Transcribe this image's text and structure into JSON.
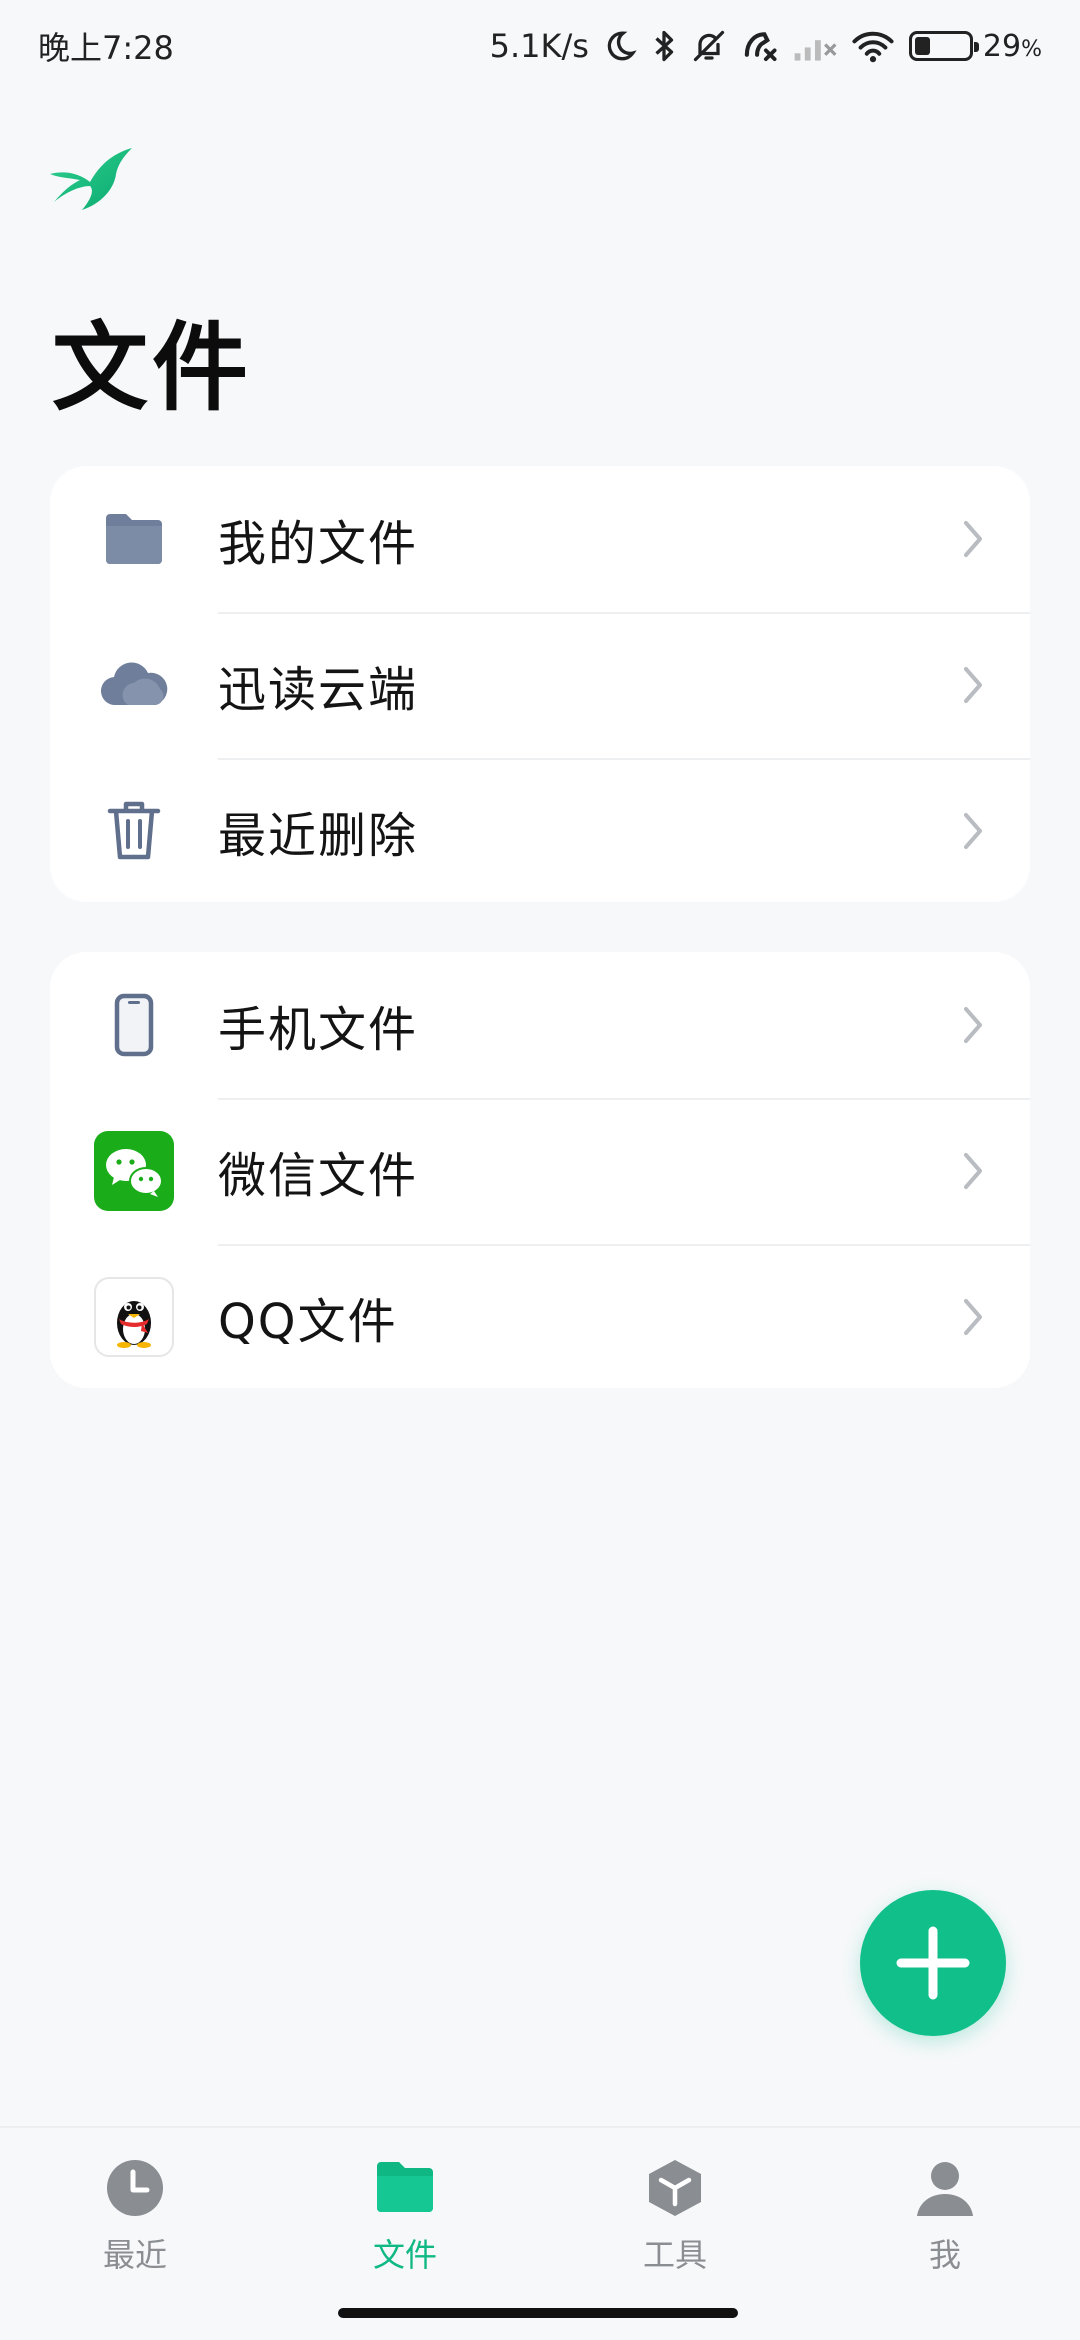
{
  "status_bar": {
    "time": "晚上7:28",
    "network_speed": "5.1K/s",
    "battery_percent": "29",
    "battery_unit": "%",
    "battery_level": 0.29
  },
  "page": {
    "title": "文件"
  },
  "groups": [
    {
      "items": [
        {
          "label": "我的文件",
          "icon": "folder-icon"
        },
        {
          "label": "迅读云端",
          "icon": "cloud-icon"
        },
        {
          "label": "最近删除",
          "icon": "trash-icon"
        }
      ]
    },
    {
      "items": [
        {
          "label": "手机文件",
          "icon": "phone-icon"
        },
        {
          "label": "微信文件",
          "icon": "wechat-icon"
        },
        {
          "label": "QQ文件",
          "icon": "qq-icon"
        }
      ]
    }
  ],
  "bottom_nav": {
    "items": [
      {
        "label": "最近",
        "icon": "clock-icon",
        "active": false
      },
      {
        "label": "文件",
        "icon": "folder-icon",
        "active": true
      },
      {
        "label": "工具",
        "icon": "box-icon",
        "active": false
      },
      {
        "label": "我",
        "icon": "user-icon",
        "active": false
      }
    ]
  },
  "colors": {
    "accent": "#11bf8a",
    "background": "#f6f8fa",
    "card": "#ffffff",
    "icon_slate": "#6f7f9b",
    "wechat_green": "#1aad19"
  }
}
